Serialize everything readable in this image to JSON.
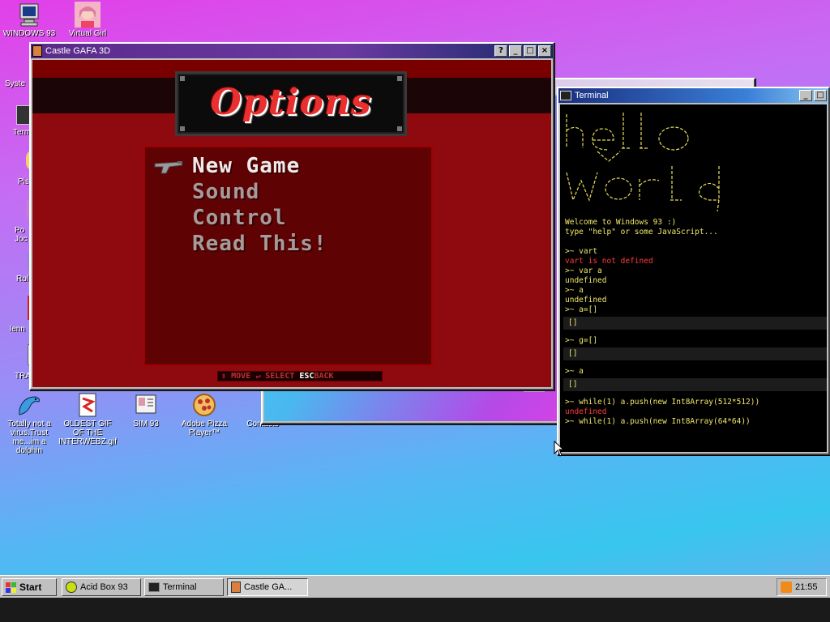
{
  "desktop": {
    "icons": [
      {
        "label": "WINDOWS 93"
      },
      {
        "label": "Virtual Girl"
      },
      {
        "label": "Totally not a virus.Trust me...im a dolphin"
      },
      {
        "label": "OLDEST GIF OF THE INTERWEBZ.gif"
      },
      {
        "label": "SIM 93"
      },
      {
        "label": "Adobe Pizza Player™"
      },
      {
        "label": "Contacts"
      }
    ],
    "partial_left_labels": [
      "Syste",
      "Term",
      "Pis",
      "Po Joc",
      "Rol",
      "lenn",
      "TRA"
    ]
  },
  "game_window": {
    "title": "Castle GAFA 3D",
    "heading": "Options",
    "menu": [
      {
        "label": "New Game",
        "selected": true
      },
      {
        "label": "Sound",
        "selected": false
      },
      {
        "label": "Control",
        "selected": false
      },
      {
        "label": "Read This!",
        "selected": false
      }
    ],
    "hint": {
      "move": "MOVE",
      "select": "SELECT",
      "esc": "ESC",
      "back": "BACK"
    }
  },
  "terminal_window": {
    "title": "Terminal",
    "welcome": "Welcome to Windows 93 :)",
    "help": "type \"help\" or some JavaScript...",
    "lines": [
      {
        "text": ">~ vart",
        "kind": "cmd"
      },
      {
        "text": "vart is not defined",
        "kind": "err"
      },
      {
        "text": ">~ var a",
        "kind": "cmd"
      },
      {
        "text": "undefined",
        "kind": "out"
      },
      {
        "text": ">~ a",
        "kind": "cmd"
      },
      {
        "text": "undefined",
        "kind": "out"
      },
      {
        "text": ">~ a=[]",
        "kind": "cmd"
      },
      {
        "text": "[]",
        "kind": "block"
      },
      {
        "text": ">~ g=[]",
        "kind": "cmd"
      },
      {
        "text": "[]",
        "kind": "block"
      },
      {
        "text": ">~ a",
        "kind": "cmd"
      },
      {
        "text": "[]",
        "kind": "block"
      },
      {
        "text": ">~ while(1) a.push(new Int8Array(512*512))",
        "kind": "cmd"
      },
      {
        "text": "undefined",
        "kind": "err"
      },
      {
        "text": ">~ while(1) a.push(new Int8Array(64*64))",
        "kind": "cmd"
      }
    ]
  },
  "taskbar": {
    "start": "Start",
    "tasks": [
      {
        "label": "Acid Box 93"
      },
      {
        "label": "Terminal"
      },
      {
        "label": "Castle GA..."
      }
    ],
    "clock": "21:55"
  }
}
